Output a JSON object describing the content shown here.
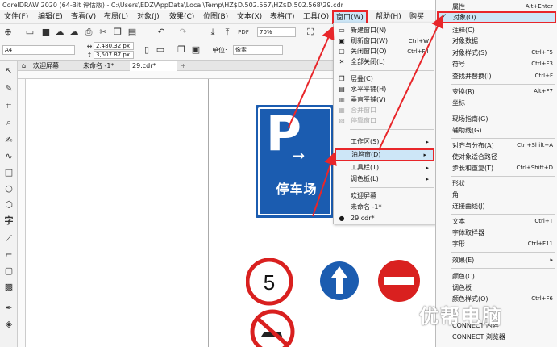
{
  "app": {
    "title": "CorelDRAW 2020 (64-Bit 评估版) - C:\\Users\\EDZ\\AppData\\Local\\Temp\\HZ$D.502.567\\HZ$D.502.568\\29.cdr"
  },
  "menubar": {
    "items": [
      "文件(F)",
      "编辑(E)",
      "查看(V)",
      "布局(L)",
      "对象(J)",
      "效果(C)",
      "位图(B)",
      "文本(X)",
      "表格(T)",
      "工具(O)",
      "窗口(W)",
      "帮助(H)",
      "购买"
    ]
  },
  "toolbar": {
    "zoom": "70%"
  },
  "propbar": {
    "page_size": "A4",
    "width": "2,480.32 px",
    "height": "3,507.87 px",
    "units_label": "单位:",
    "units_value": "像素"
  },
  "tabs": [
    "欢迎屏幕",
    "未命名 -1*",
    "29.cdr*"
  ],
  "sign": {
    "letter": "P",
    "text": "停车场"
  },
  "window_menu": {
    "items": [
      {
        "label": "新建窗口(N)",
        "shortcut": ""
      },
      {
        "label": "刷新窗口(W)",
        "shortcut": "Ctrl+W"
      },
      {
        "label": "关闭窗口(O)",
        "shortcut": "Ctrl+F4"
      },
      {
        "label": "全部关闭(L)",
        "shortcut": ""
      },
      {
        "label": "层叠(C)",
        "shortcut": ""
      },
      {
        "label": "水平平铺(H)",
        "shortcut": ""
      },
      {
        "label": "垂直平铺(V)",
        "shortcut": ""
      },
      {
        "label": "合并窗口",
        "shortcut": ""
      },
      {
        "label": "停靠窗口",
        "shortcut": ""
      },
      {
        "label": "工作区(S)",
        "shortcut": ""
      },
      {
        "label": "泊坞窗(D)",
        "shortcut": ""
      },
      {
        "label": "工具栏(T)",
        "shortcut": ""
      },
      {
        "label": "调色板(L)",
        "shortcut": ""
      },
      {
        "label": "欢迎屏幕",
        "shortcut": ""
      },
      {
        "label": "未命名 -1*",
        "shortcut": ""
      },
      {
        "label": "29.cdr*",
        "shortcut": ""
      }
    ]
  },
  "docker_menu": {
    "items": [
      {
        "label": "属性",
        "shortcut": "Alt+Enter"
      },
      {
        "label": "对象(O)",
        "shortcut": ""
      },
      {
        "label": "注释(C)",
        "shortcut": ""
      },
      {
        "label": "对象数据",
        "shortcut": ""
      },
      {
        "label": "对象样式(S)",
        "shortcut": "Ctrl+F5"
      },
      {
        "label": "符号",
        "shortcut": "Ctrl+F3"
      },
      {
        "label": "查找并替换(I)",
        "shortcut": "Ctrl+F"
      },
      {
        "label": "变换(R)",
        "shortcut": "Alt+F7"
      },
      {
        "label": "坐标",
        "shortcut": ""
      },
      {
        "label": "现场指南(G)",
        "shortcut": ""
      },
      {
        "label": "辅助线(G)",
        "shortcut": ""
      },
      {
        "label": "对齐与分布(A)",
        "shortcut": "Ctrl+Shift+A"
      },
      {
        "label": "使对象适合路径",
        "shortcut": ""
      },
      {
        "label": "步长和重复(T)",
        "shortcut": "Ctrl+Shift+D"
      },
      {
        "label": "形状",
        "shortcut": ""
      },
      {
        "label": "角",
        "shortcut": ""
      },
      {
        "label": "连接曲线(J)",
        "shortcut": ""
      },
      {
        "label": "文本",
        "shortcut": "Ctrl+T"
      },
      {
        "label": "字体取样器",
        "shortcut": ""
      },
      {
        "label": "字形",
        "shortcut": "Ctrl+F11"
      },
      {
        "label": "效果(E)",
        "shortcut": ""
      },
      {
        "label": "颜色(C)",
        "shortcut": ""
      },
      {
        "label": "调色板",
        "shortcut": ""
      },
      {
        "label": "颜色样式(O)",
        "shortcut": "Ctrl+F6"
      },
      {
        "label": "CONNECT 内容",
        "shortcut": ""
      },
      {
        "label": "CONNECT 浏览器",
        "shortcut": ""
      }
    ]
  },
  "watermark": "优帮电脑",
  "colors": {
    "highlight_red": "#e8262a",
    "sign_blue": "#1b5cb0",
    "no_entry_red": "#d9201f",
    "menu_highlight": "#cde6f7"
  }
}
